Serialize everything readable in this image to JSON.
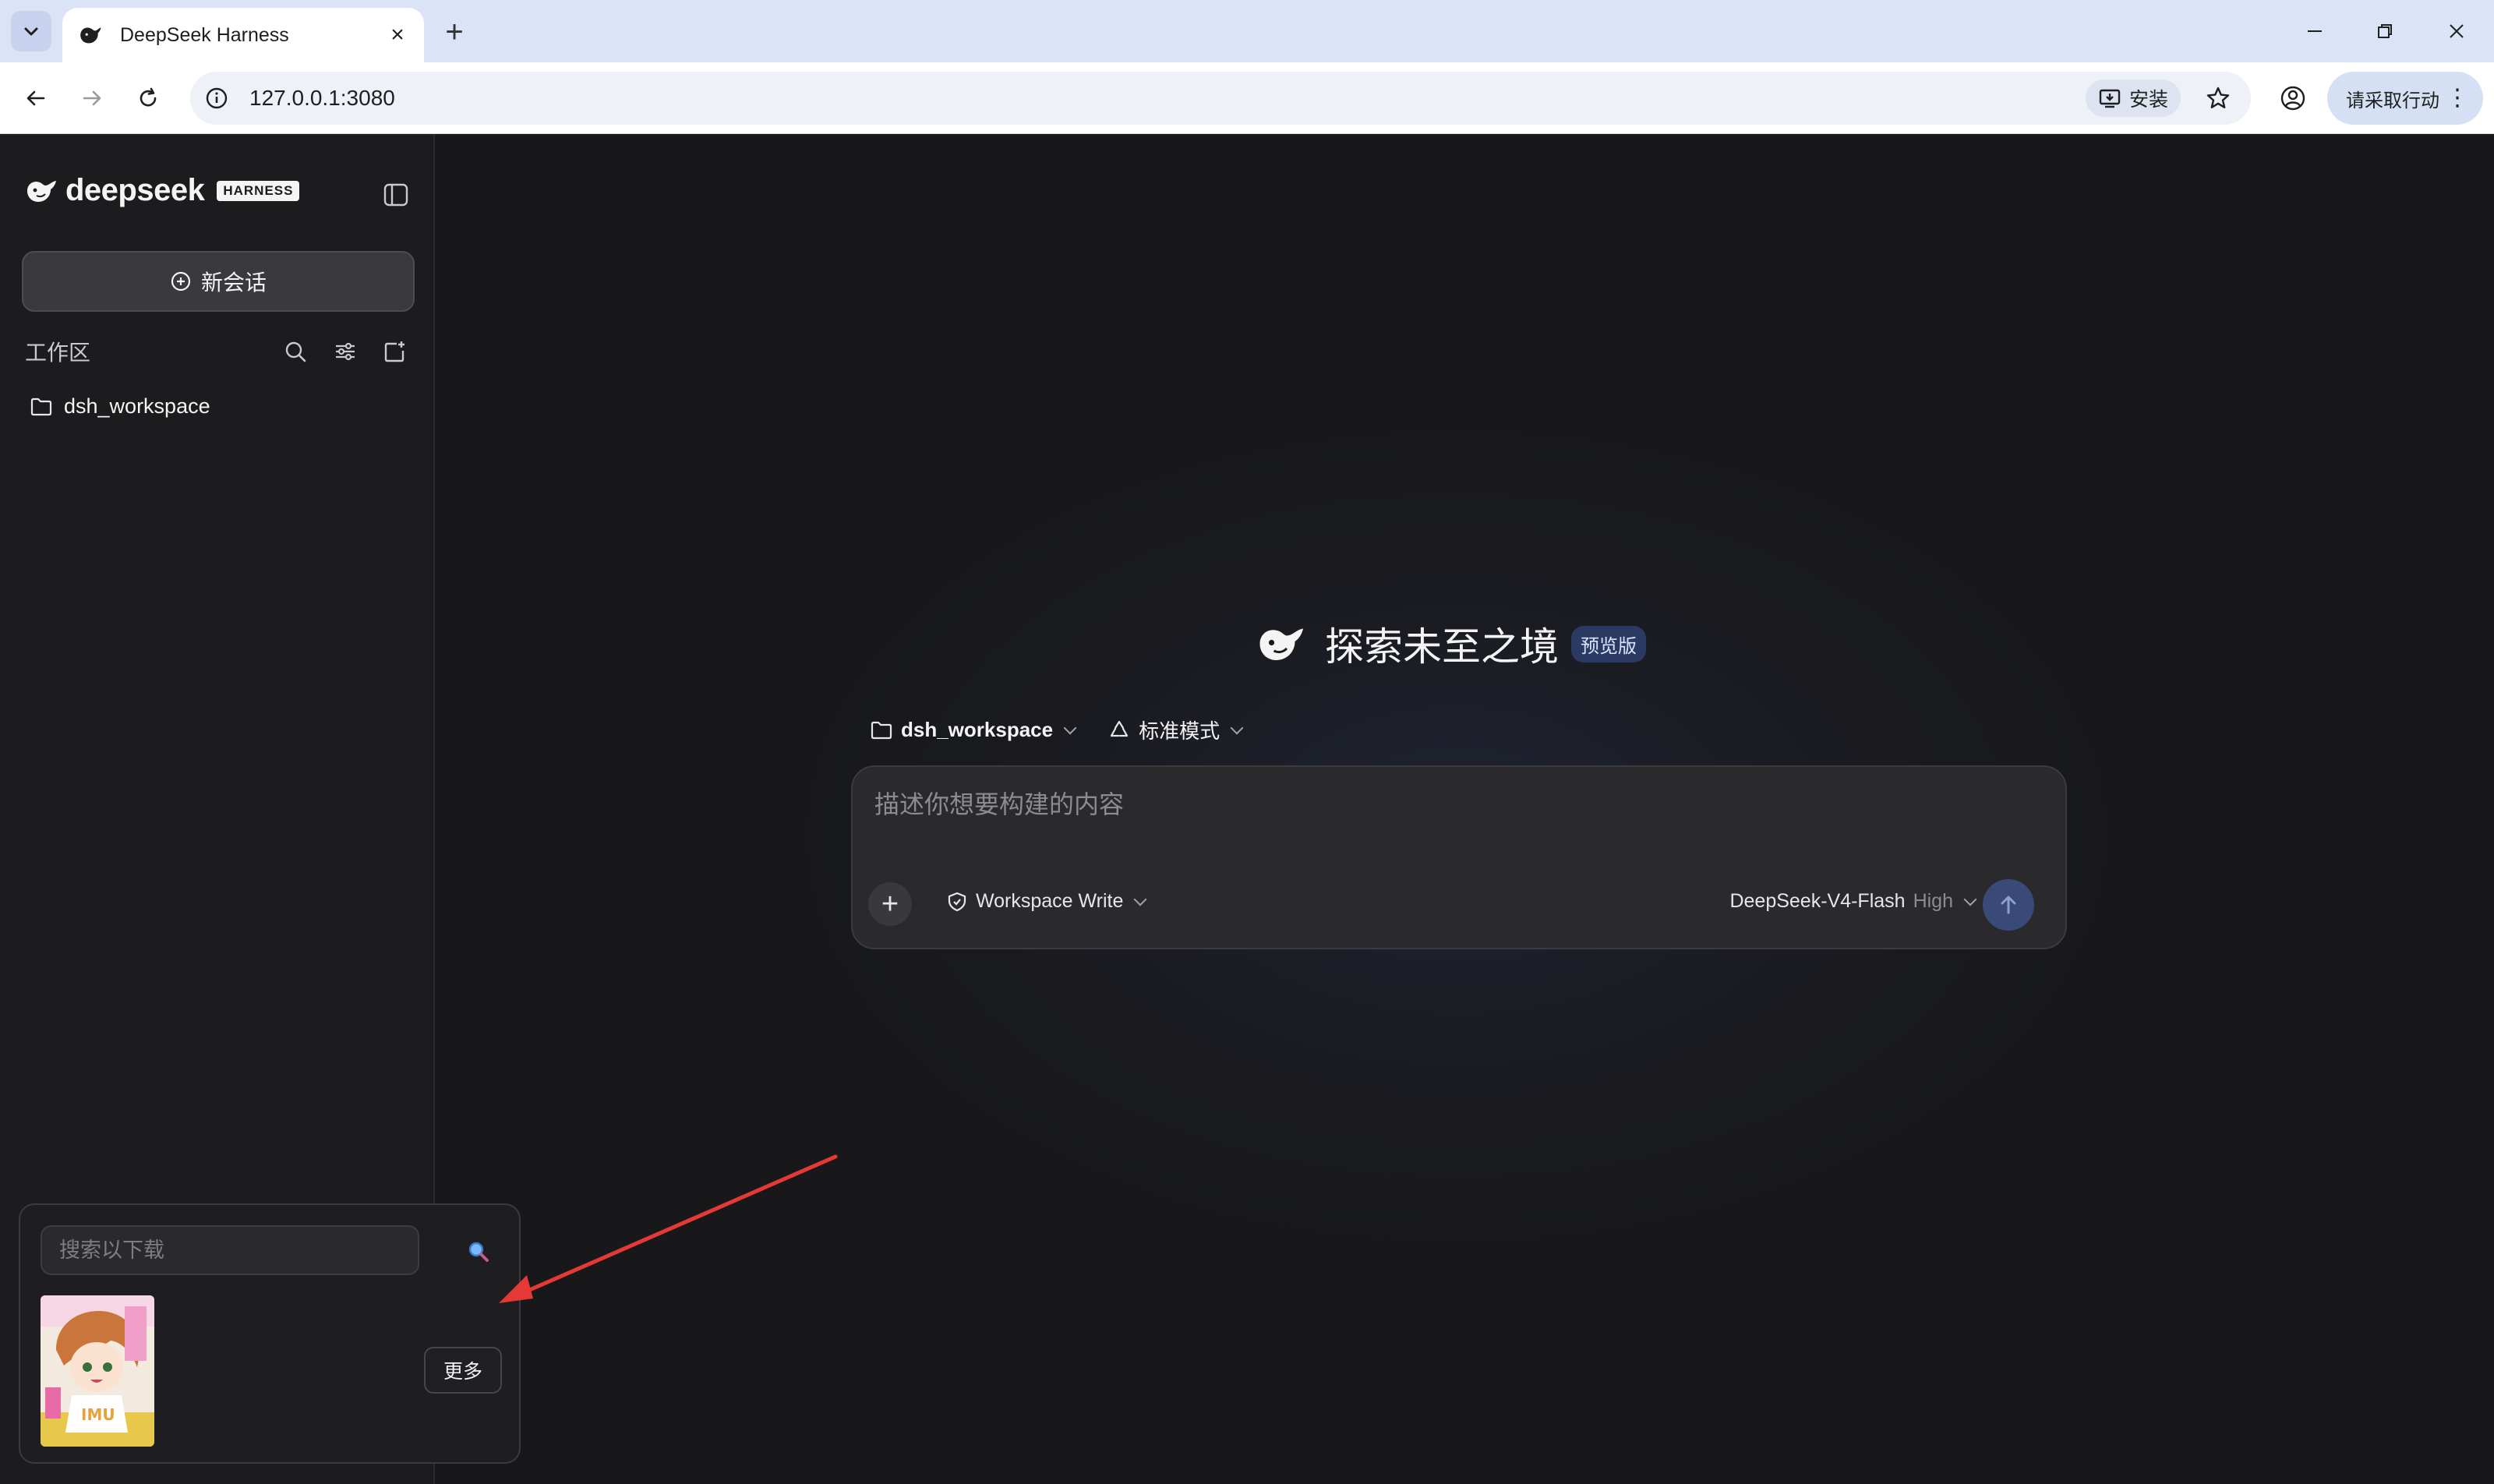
{
  "browser": {
    "tab_title": "DeepSeek Harness",
    "url": "127.0.0.1:3080",
    "install_label": "安装",
    "action_label": "请采取行动"
  },
  "sidebar": {
    "brand_word": "deepseek",
    "brand_badge": "HARNESS",
    "new_chat_label": "新会话",
    "workspace_title": "工作区",
    "workspaces": [
      {
        "name": "dsh_workspace",
        "icon": "folder-icon"
      }
    ]
  },
  "main": {
    "hero_title": "探索未至之境",
    "hero_badge": "预览版",
    "workspace_selector": "dsh_workspace",
    "mode_selector": "标准模式",
    "composer": {
      "placeholder": "描述你想要构建的内容",
      "value": "",
      "permission": "Workspace Write",
      "model": "DeepSeek-V4-Flash",
      "model_level": "High"
    }
  },
  "popup": {
    "search_placeholder": "搜索以下载",
    "more_label": "更多"
  },
  "colors": {
    "accent": "#3a4a78",
    "badge_bg": "#2b3a63",
    "annotation_arrow": "#e53935"
  }
}
